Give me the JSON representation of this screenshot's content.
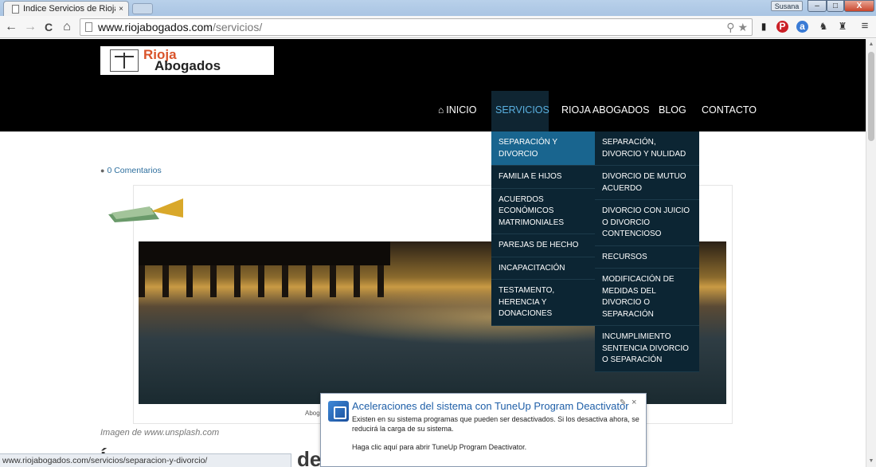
{
  "browser": {
    "tab_title": "Indice Servicios de Rioja A",
    "tab_close": "×",
    "user_name": "Susana",
    "window_buttons": [
      "–",
      "□",
      "X"
    ],
    "url_host": "www.riojabogados.com",
    "url_path": "/servicios/",
    "nav": {
      "back": "←",
      "forward": "→",
      "reload": "C",
      "home": "⌂"
    },
    "omnibox_icons": "⚲ ★",
    "extensions": [
      "▮",
      "P",
      "a",
      "♞",
      "♜",
      "≡"
    ],
    "status_url": "www.riojabogados.com/servicios/separacion-y-divorcio/"
  },
  "site": {
    "logo_line1": "Rioja",
    "logo_line2": "Abogados",
    "menu": [
      {
        "label": "INICIO",
        "icon": "home-icon"
      },
      {
        "label": "SERVICIOS",
        "active": true
      },
      {
        "label": "RIOJA ABOGADOS"
      },
      {
        "label": "BLOG"
      },
      {
        "label": "CONTACTO"
      }
    ],
    "submenu": [
      "SEPARACIÓN Y DIVORCIO",
      "FAMILIA E HIJOS",
      "ACUERDOS ECONÓMICOS MATRIMONIALES",
      "PAREJAS DE HECHO",
      "INCAPACITACIÓN",
      "TESTAMENTO, HERENCIA Y DONACIONES"
    ],
    "subsubmenu": [
      "SEPARACIÓN, DIVORCIO Y NULIDAD",
      "DIVORCIO DE MUTUO ACUERDO",
      "DIVORCIO CON JUICIO O DIVORCIO CONTENCIOSO",
      "RECURSOS",
      "MODIFICACIÓN DE MEDIDAS DEL DIVORCIO O SEPARACIÓN",
      "INCUMPLIMIENTO SENTENCIA DIVORCIO O SEPARACIÓN"
    ],
    "comments_label": "0 Comentarios",
    "photo_credit_inline": "Abog",
    "caption": "Imagen de www.unsplash.com",
    "heading_start": "Í",
    "heading_tail": "de"
  },
  "toast": {
    "title": "Aceleraciones del sistema con TuneUp Program Deactivator",
    "body": "Existen en su sistema programas que pueden ser desactivados. Si los desactiva ahora, se reducirá la carga de su sistema.",
    "link": "Haga clic aquí para abrir TuneUp Program Deactivator.",
    "pin": "✎",
    "close": "×"
  },
  "colors": {
    "header_bg": "#000000",
    "menu_active_bg": "#0f2532",
    "menu_active_text": "#5ab0e0",
    "dropdown_bg": "#0c2533",
    "dropdown_active_bg": "#19658f",
    "logo_accent": "#d9532a",
    "toast_title": "#1f5fa8"
  }
}
